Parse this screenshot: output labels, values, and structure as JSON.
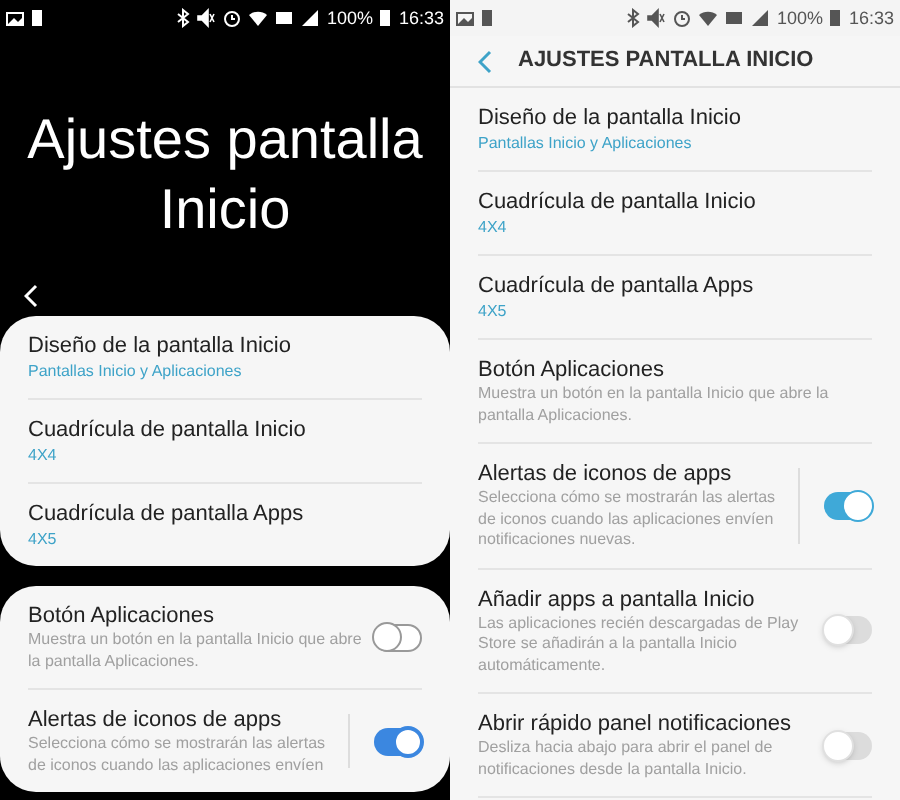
{
  "screens": [
    {
      "kind": "expanded",
      "status_bar": {
        "battery": "100%",
        "time": "16:33"
      },
      "title": "Ajustes pantalla Inicio",
      "groups": [
        [
          {
            "kind": "link",
            "title": "Diseño de la pantalla Inicio",
            "summary": "Pantallas Inicio y Aplicaciones"
          },
          {
            "kind": "link",
            "title": "Cuadrícula de pantalla Inicio",
            "summary": "4X4"
          },
          {
            "kind": "link",
            "title": "Cuadrícula de pantalla Apps",
            "summary": "4X5"
          }
        ],
        [
          {
            "kind": "switch",
            "title": "Botón Aplicaciones",
            "description": "Muestra un botón en la pantalla Inicio que abre la pantalla Aplicaciones.",
            "on": false
          },
          {
            "kind": "split_switch",
            "title": "Alertas de iconos de apps",
            "description": "Selecciona cómo se mostrarán las alertas de iconos cuando las aplicaciones envíen",
            "on": true
          }
        ]
      ]
    },
    {
      "kind": "toolbar",
      "status_bar": {
        "battery": "100%",
        "time": "16:33"
      },
      "title": "AJUSTES PANTALLA INICIO",
      "groups": [
        [
          {
            "kind": "link",
            "title": "Diseño de la pantalla Inicio",
            "summary": "Pantallas Inicio y Aplicaciones"
          },
          {
            "kind": "link",
            "title": "Cuadrícula de pantalla Inicio",
            "summary": "4X4"
          },
          {
            "kind": "link",
            "title": "Cuadrícula de pantalla Apps",
            "summary": "4X5"
          },
          {
            "kind": "text",
            "title": "Botón Aplicaciones",
            "description": "Muestra un botón en la pantalla Inicio que abre la pantalla Aplicaciones."
          },
          {
            "kind": "split_switch",
            "title": "Alertas de iconos de apps",
            "description": "Selecciona cómo se mostrarán las alertas de iconos cuando las aplicaciones envíen notificaciones nuevas.",
            "on": true
          },
          {
            "kind": "switch",
            "title": "Añadir apps a pantalla Inicio",
            "description": "Las aplicaciones recién descargadas de Play Store se añadirán a la pantalla Inicio automáticamente.",
            "on": false
          },
          {
            "kind": "switch",
            "title": "Abrir rápido panel notificaciones",
            "description": "Desliza hacia abajo para abrir el panel de notificaciones desde la pantalla Inicio.",
            "on": false
          }
        ]
      ]
    }
  ]
}
